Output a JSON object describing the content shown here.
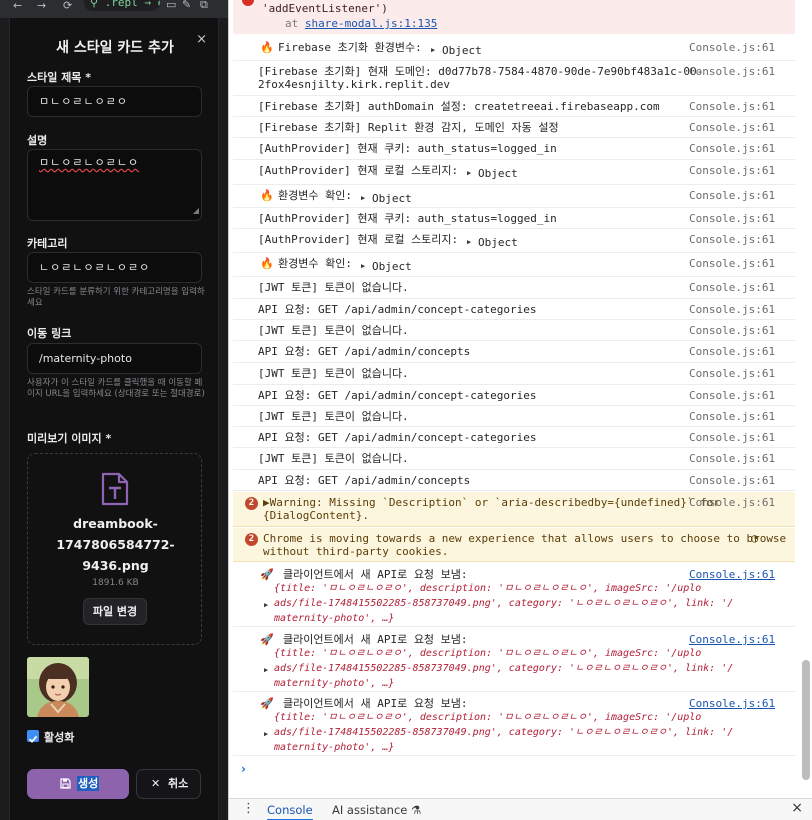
{
  "browser": {
    "back_icon": "←",
    "forward_icon": "→",
    "reload_icon": "⟳",
    "url_text": "⚲ .repl → e"
  },
  "modal": {
    "title": "새 스타일 카드 추가",
    "close_icon": "×",
    "fields": {
      "title_label": "스타일 제목 *",
      "title_value": "ㅁㄴㅇㄹㄴㅇㄹㅇ",
      "desc_label": "설명",
      "desc_value": "ㅁㄴㅇㄹㄴㅇㄹㄴㅇ",
      "category_label": "카테고리",
      "category_value": "ㄴㅇㄹㄴㅇㄹㄴㅇㄹㅇ",
      "category_help": "스타일 카드를 분류하기 위한 카테고리명을 입력하세요",
      "link_label": "이동 링크",
      "link_value": "/maternity-photo",
      "link_help": "사용자가 이 스타일 카드를 클릭했을 때 이동할 페이지 URL을 입력하세요 (상대경로 또는 절대경로)",
      "preview_label": "미리보기 이미지 *"
    },
    "upload": {
      "file_name": "dreambook-\n1747806584772-\n9436.png",
      "file_size": "1891.6 KB",
      "change_button": "파일 변경"
    },
    "active_label": "활성화",
    "active_checked": true,
    "create_button": "생성",
    "cancel_button": "취소",
    "accent_color": "#8e63ad"
  },
  "console": {
    "error_top": {
      "line1": "'addEventListener')",
      "at": "at",
      "link": "share-modal.js:1:135"
    },
    "rows": [
      {
        "text": "Firebase 초기화 환경변수:",
        "obj": "Object",
        "src": "Console.js:61",
        "icon": "fire"
      },
      {
        "text": "[Firebase 초기화] 현재 도메인: d0d77b78-7584-4870-90de-7e90bf483a1c-00-\n2fox4esnjilty.kirk.replit.dev",
        "src": "Console.js:61"
      },
      {
        "text": "[Firebase 초기화] authDomain 설정: createtreeai.firebaseapp.com",
        "src": "Console.js:61"
      },
      {
        "text": "[Firebase 초기화] Replit 환경 감지, 도메인 자동 설정",
        "src": "Console.js:61"
      },
      {
        "text": "[AuthProvider] 현재 쿠키: auth_status=logged_in",
        "src": "Console.js:61"
      },
      {
        "text": "[AuthProvider] 현재 로컬 스토리지:",
        "obj": "Object",
        "src": "Console.js:61"
      },
      {
        "text": "환경변수 확인:",
        "obj": "Object",
        "src": "Console.js:61",
        "icon": "fire"
      },
      {
        "text": "[AuthProvider] 현재 쿠키: auth_status=logged_in",
        "src": "Console.js:61"
      },
      {
        "text": "[AuthProvider] 현재 로컬 스토리지:",
        "obj": "Object",
        "src": "Console.js:61"
      },
      {
        "text": "환경변수 확인:",
        "obj": "Object",
        "src": "Console.js:61",
        "icon": "fire"
      },
      {
        "text": "[JWT 토큰] 토큰이 없습니다.",
        "src": "Console.js:61"
      },
      {
        "text": "API 요청: GET /api/admin/concept-categories",
        "src": "Console.js:61"
      },
      {
        "text": "[JWT 토큰] 토큰이 없습니다.",
        "src": "Console.js:61"
      },
      {
        "text": "API 요청: GET /api/admin/concepts",
        "src": "Console.js:61"
      },
      {
        "text": "[JWT 토큰] 토큰이 없습니다.",
        "src": "Console.js:61"
      },
      {
        "text": "API 요청: GET /api/admin/concept-categories",
        "src": "Console.js:61"
      },
      {
        "text": "[JWT 토큰] 토큰이 없습니다.",
        "src": "Console.js:61"
      },
      {
        "text": "API 요청: GET /api/admin/concept-categories",
        "src": "Console.js:61"
      },
      {
        "text": "[JWT 토큰] 토큰이 없습니다.",
        "src": "Console.js:61"
      },
      {
        "text": "API 요청: GET /api/admin/concepts",
        "src": "Console.js:61"
      }
    ],
    "warnings": [
      {
        "count": "2",
        "text": "▶Warning: Missing `Description` or `aria-describedby={undefined}` for\n{DialogContent}.",
        "src": "Console.js:61"
      },
      {
        "count": "2",
        "text": "Chrome is moving towards a new experience that allows users to choose to browse\nwithout third-party cookies.",
        "src": ""
      }
    ],
    "client_logs": [
      {
        "text": "클라이언트에서 새 API로 요청 보냄:",
        "src": "Console.js:61"
      },
      {
        "text": "클라이언트에서 새 API로 요청 보냄:",
        "src": "Console.js:61"
      },
      {
        "text": "클라이언트에서 새 API로 요청 보냄:",
        "src": "Console.js:61"
      }
    ],
    "obj_line1": "{title: 'ㅁㄴㅇㄹㄴㅇㄹㅇ', description: 'ㅁㄴㅇㄹㄴㅇㄹㄴㅇ', imageSrc: '/uplo",
    "obj_line2": "ads/file-1748415502285-858737049.png', category: 'ㄴㅇㄹㄴㅇㄹㄴㅇㄹㅇ', link: '/",
    "obj_line3": "maternity-photo', …}",
    "prompt": "›",
    "drawer": {
      "menu_icon": "⋮",
      "tab_console": "Console",
      "tab_ai": "AI assistance ⚗",
      "close_icon": "×"
    }
  }
}
